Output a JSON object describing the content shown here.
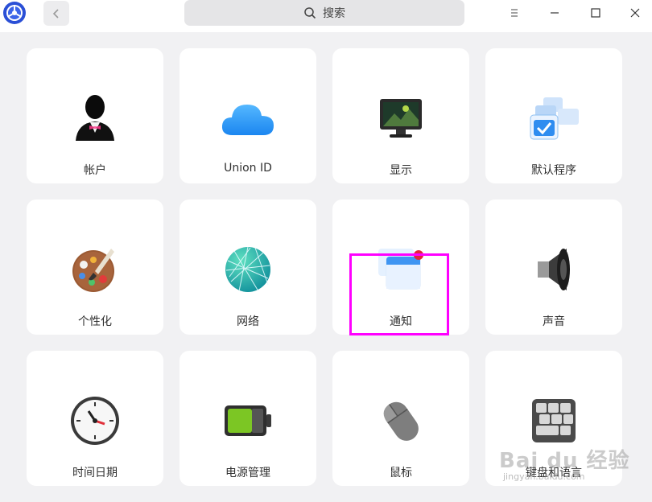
{
  "titlebar": {
    "search_placeholder": "搜索"
  },
  "cards": [
    {
      "label": "帐户",
      "icon": "account-icon"
    },
    {
      "label": "Union ID",
      "icon": "cloud-icon"
    },
    {
      "label": "显示",
      "icon": "display-icon"
    },
    {
      "label": "默认程序",
      "icon": "default-apps-icon"
    },
    {
      "label": "个性化",
      "icon": "palette-icon"
    },
    {
      "label": "网络",
      "icon": "network-icon"
    },
    {
      "label": "通知",
      "icon": "notification-icon"
    },
    {
      "label": "声音",
      "icon": "speaker-icon"
    },
    {
      "label": "时间日期",
      "icon": "clock-icon"
    },
    {
      "label": "电源管理",
      "icon": "battery-icon"
    },
    {
      "label": "鼠标",
      "icon": "mouse-icon"
    },
    {
      "label": "键盘和语言",
      "icon": "keyboard-icon"
    }
  ],
  "watermark": {
    "main": "Bai du 经验",
    "sub": "jingyan.baidu.com"
  },
  "colors": {
    "highlight": "#ff00ff",
    "card_bg": "#ffffff",
    "page_bg": "#f1f1f3"
  }
}
